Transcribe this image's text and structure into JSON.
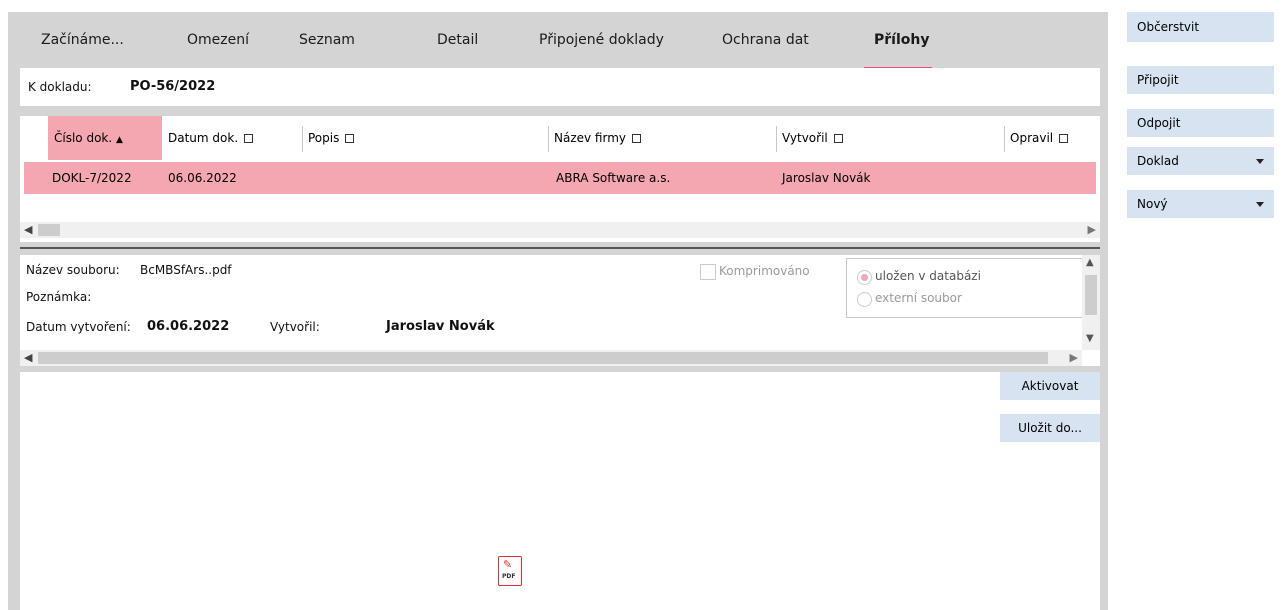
{
  "tabs": [
    {
      "label": "Začínáme..."
    },
    {
      "label": "Omezení"
    },
    {
      "label": "Seznam"
    },
    {
      "label": "Detail"
    },
    {
      "label": "Připojené doklady"
    },
    {
      "label": "Ochrana dat"
    },
    {
      "label": "Přílohy"
    }
  ],
  "header": {
    "label": "K dokladu:",
    "value": "PO-56/2022"
  },
  "grid": {
    "columns": [
      "Číslo dok.",
      "Datum dok.",
      "Popis",
      "Název firmy",
      "Vytvořil",
      "Opravil"
    ],
    "rows": [
      {
        "cislo": "DOKL-7/2022",
        "datum": "06.06.2022",
        "popis": "",
        "firma": "ABRA Software a.s.",
        "vytvoril": "Jaroslav Novák",
        "opravil": ""
      }
    ]
  },
  "detail": {
    "filename_label": "Název souboru:",
    "filename_value": "BcMBSfArs..pdf",
    "note_label": "Poznámka:",
    "created_label": "Datum vytvoření:",
    "created_value": "06.06.2022",
    "author_label": "Vytvořil:",
    "author_value": "Jaroslav Novák",
    "compressed_label": "Komprimováno",
    "storage_options": [
      "uložen v databázi",
      "externí soubor"
    ]
  },
  "preview": {
    "activate_label": "Aktivovat",
    "save_to_label": "Uložit do...",
    "file_icon_text": "PDF"
  },
  "sidebar": {
    "refresh": "Občerstvit",
    "attach": "Připojit",
    "detach": "Odpojit",
    "document": "Doklad",
    "new": "Nový"
  },
  "colors": {
    "accent": "#e0506a",
    "selected_row": "#f4a6b1",
    "button_bg": "#d7e3f0"
  }
}
